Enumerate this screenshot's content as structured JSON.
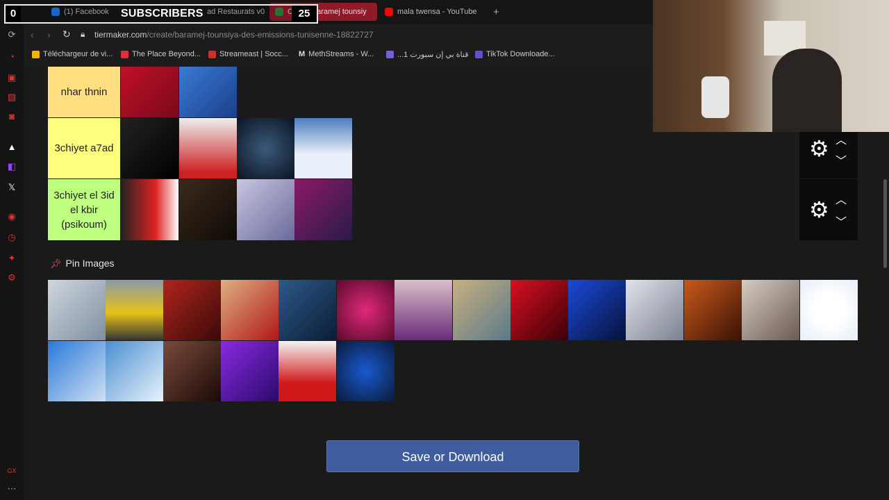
{
  "overlay": {
    "left_value": "0",
    "label": "SUBSCRIBERS",
    "count": "25"
  },
  "tabs": [
    {
      "label": "(1) Facebook",
      "favicon_color": "#1877f2"
    },
    {
      "label": "ad Restaurats v0",
      "favicon_color": "#888888"
    },
    {
      "label": "Create baramej tounsiy",
      "favicon_color": "#2b8a3e"
    },
    {
      "label": "mala twensa - YouTube",
      "favicon_color": "#ff0000"
    }
  ],
  "new_tab_icon": "plus-icon",
  "address": {
    "domain": "tiermaker.com",
    "path": "/create/baramej-tounsiya-des-emissions-tunisenne-18822727"
  },
  "bookmarks": [
    {
      "label": "Téléchargeur de vi...",
      "color": "#f5b400"
    },
    {
      "label": "The Place Beyond...",
      "color": "#e03030"
    },
    {
      "label": "Streameast | Socc...",
      "color": "#d0302a"
    },
    {
      "label": "MethStreams - W...",
      "color": "#dddddd"
    },
    {
      "label": "...قناة بي إن سبورت 1",
      "color": "#7b5cd6"
    },
    {
      "label": "TikTok Downloade...",
      "color": "#6a4cc9"
    }
  ],
  "tiers": [
    {
      "label": "nhar thnin",
      "color": "#ffdf80",
      "tiles": [
        "tile-1",
        "tile-2"
      ]
    },
    {
      "label": "3chiyet a7ad",
      "color": "#ffff7f",
      "tiles": [
        "tile-1",
        "tile-2",
        "tile-3",
        "tile-4"
      ]
    },
    {
      "label": "3chiyet el 3id el kbir (psikoum)",
      "color": "#bfff7f",
      "tiles": [
        "tile-1",
        "tile-2",
        "tile-3",
        "tile-4"
      ]
    }
  ],
  "pin_images": {
    "title": "Pin Images",
    "count": 23
  },
  "save_button": {
    "label": "Save or Download"
  }
}
